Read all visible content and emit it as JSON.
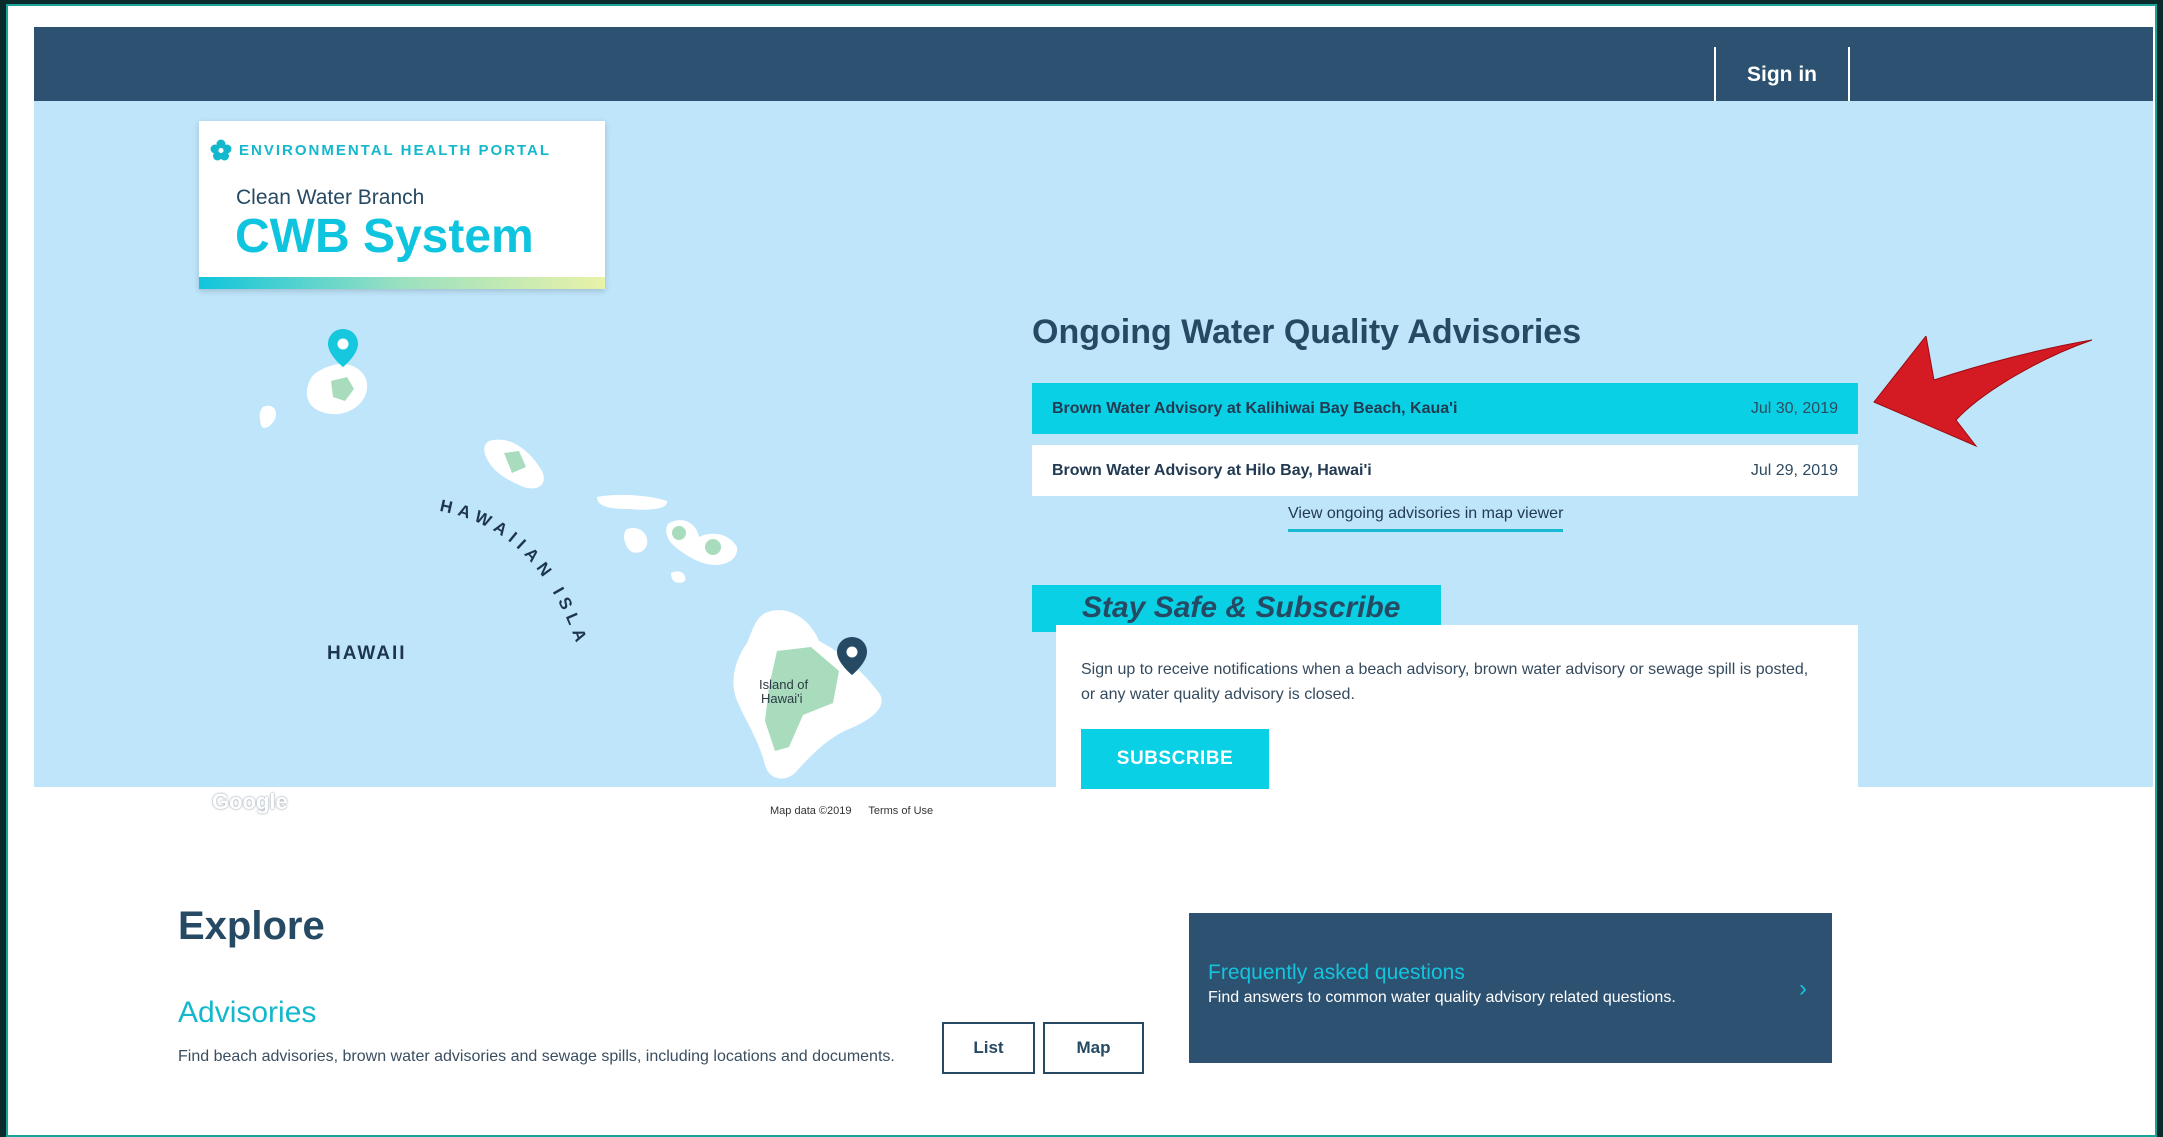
{
  "header": {
    "portal_label": "ENVIRONMENTAL HEALTH PORTAL",
    "branch": "Clean Water Branch",
    "system_name": "CWB System",
    "sign_in": "Sign in"
  },
  "map": {
    "region_label": "HAWAII",
    "islands_label": "HAWAIIAN ISLANDS",
    "island_label_line1": "Island of",
    "island_label_line2": "Hawai'i",
    "google": "Google",
    "map_data": "Map data ©2019",
    "terms": "Terms of Use"
  },
  "advisories": {
    "title": "Ongoing Water Quality Advisories",
    "items": [
      {
        "name": "Brown Water Advisory at Kalihiwai Bay Beach, Kaua'i",
        "date": "Jul 30, 2019"
      },
      {
        "name": "Brown Water Advisory at Hilo Bay, Hawai'i",
        "date": "Jul 29, 2019"
      }
    ],
    "map_link": "View ongoing advisories in map viewer"
  },
  "subscribe": {
    "title": "Stay Safe & Subscribe",
    "text": "Sign up to receive notifications when a beach advisory, brown water advisory or sewage spill is posted, or any water quality advisory is closed.",
    "button": "SUBSCRIBE"
  },
  "explore": {
    "title": "Explore",
    "advisories_heading": "Advisories",
    "advisories_text": "Find beach advisories, brown water advisories and sewage spills, including locations and documents.",
    "list_button": "List",
    "map_button": "Map"
  },
  "faq": {
    "title": "Frequently asked questions",
    "text": "Find answers to common water quality advisory related questions.",
    "chevron": "›"
  },
  "colors": {
    "navy": "#2d5170",
    "accent": "#09d0e4",
    "hero_bg": "#bfe5fb",
    "arrow": "#d41a22"
  }
}
